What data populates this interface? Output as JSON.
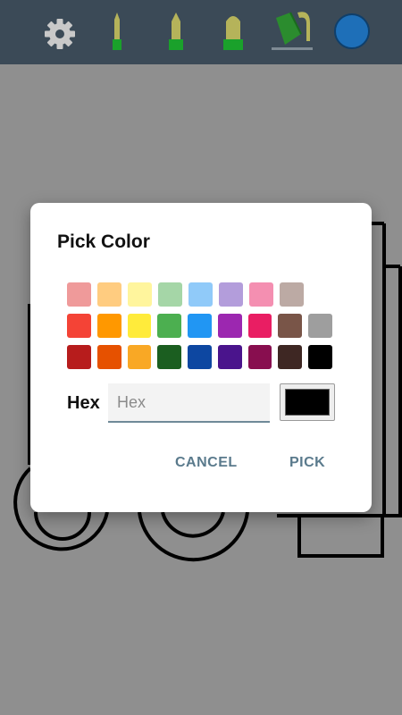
{
  "toolbar": {
    "icons": [
      "gear-icon",
      "thin-marker-icon",
      "medium-marker-icon",
      "thick-marker-icon",
      "paint-bucket-icon",
      "color-circle-icon"
    ],
    "current_color": "#1e6fb8"
  },
  "dialog": {
    "title": "Pick Color",
    "hex_label": "Hex",
    "hex_placeholder": "Hex",
    "hex_value": "",
    "preview_color": "#000000",
    "cancel_label": "CANCEL",
    "pick_label": "PICK",
    "swatches": [
      [
        "#ef9a9a",
        "#ffcc80",
        "#fff59d",
        "#a5d6a7",
        "#90caf9",
        "#b39ddb",
        "#f48fb1",
        "#bcaaa4"
      ],
      [
        "#f44336",
        "#ff9800",
        "#ffeb3b",
        "#4caf50",
        "#2196f3",
        "#9c27b0",
        "#e91e63",
        "#795548",
        "#9e9e9e"
      ],
      [
        "#b71c1c",
        "#e65100",
        "#f9a825",
        "#1b5e20",
        "#0d47a1",
        "#4a148c",
        "#880e4f",
        "#3e2723",
        "#000000"
      ]
    ]
  }
}
